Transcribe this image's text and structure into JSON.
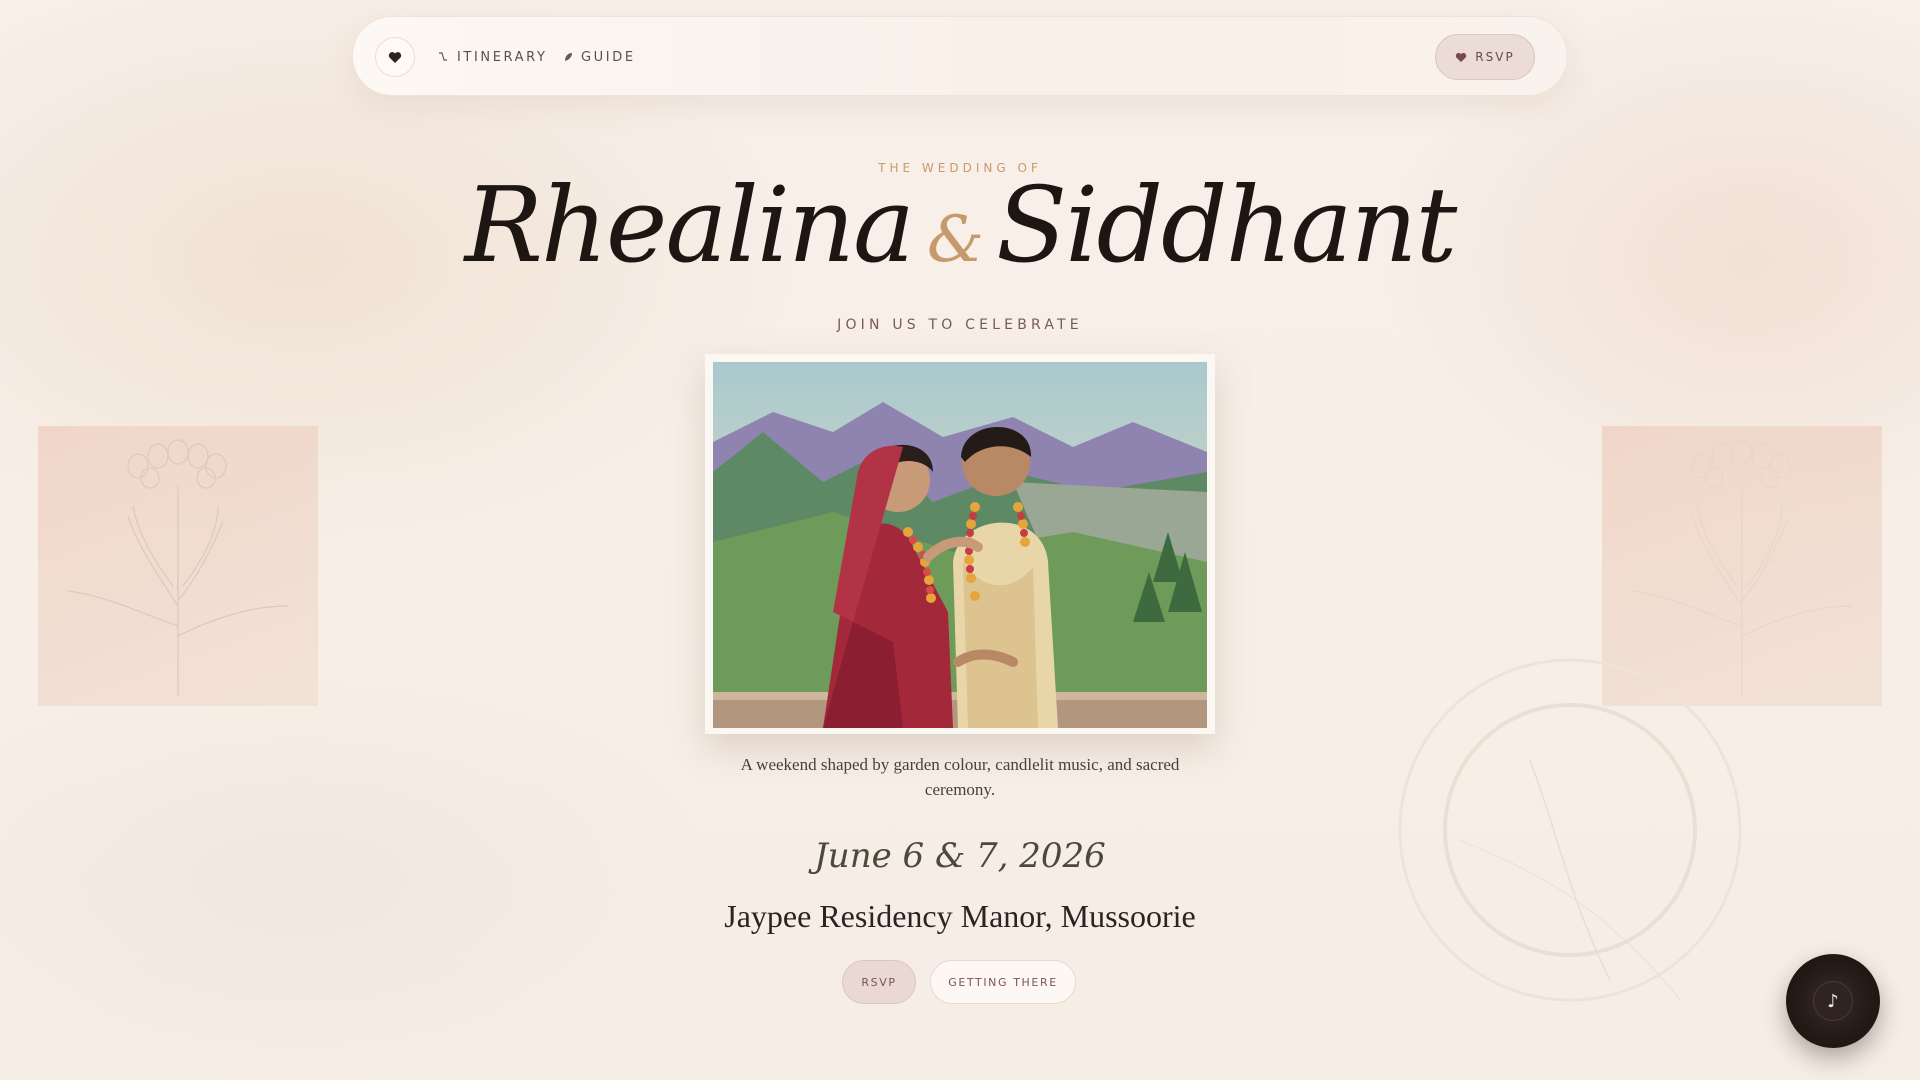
{
  "nav": {
    "heart_icon": "heart-icon",
    "itinerary_label": "ITINERARY",
    "guide_label": "GUIDE",
    "rsvp_label": "RSVP"
  },
  "hero": {
    "eyebrow": "THE WEDDING OF",
    "name_one": "Rhealina",
    "ampersand": "&",
    "name_two": "Siddhant",
    "join": "JOIN US TO CELEBRATE",
    "photo_alt": "Illustrated couple exchanging garlands with mountain view",
    "tagline": "A weekend shaped by garden colour, candlelit music, and sacred ceremony.",
    "date": "June 6 & 7, 2026",
    "venue": "Jaypee Residency Manor, Mussoorie",
    "cta_rsvp": "RSVP",
    "cta_getting_there": "GETTING THERE"
  },
  "music": {
    "icon": "♪"
  },
  "colors": {
    "accent_gold": "#c59c6a",
    "rose": "#ecdcd7",
    "ink": "#1e1613",
    "background": "#f7efe8"
  }
}
